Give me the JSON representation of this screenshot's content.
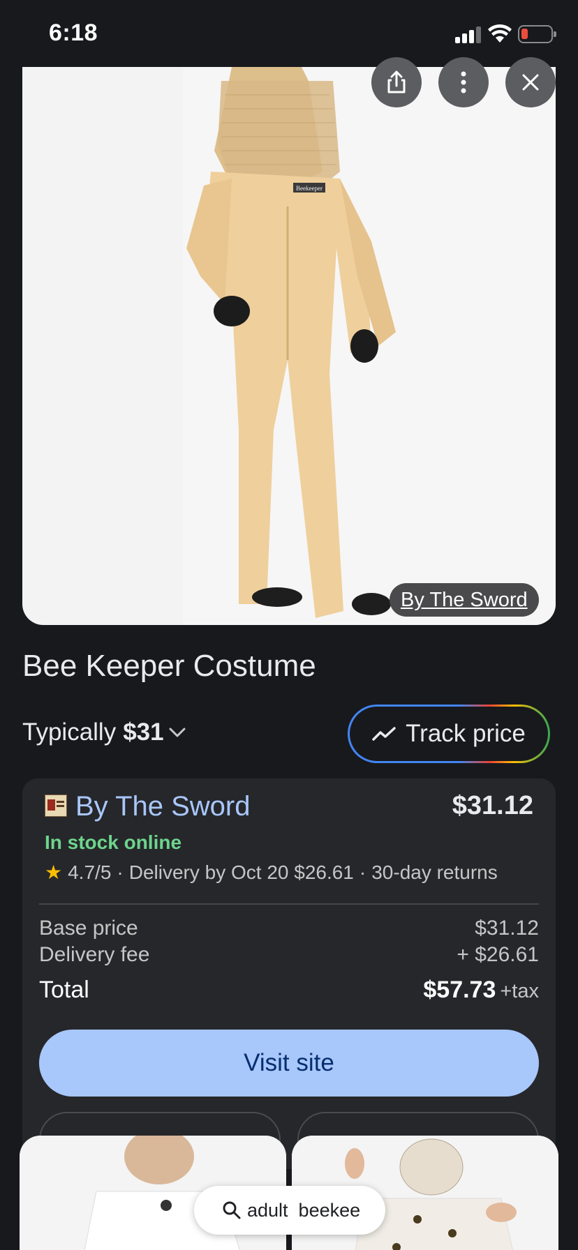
{
  "status_bar": {
    "time": "6:18",
    "icons": [
      "signal-icon",
      "wifi-icon",
      "battery-low-icon"
    ],
    "battery_color": "#eb4d3d"
  },
  "hero": {
    "image_badge": "Beekeeper",
    "source_chip": "By The Sword",
    "buttons": [
      "share-icon",
      "more-vert-icon",
      "close-icon"
    ]
  },
  "product": {
    "title": "Bee Keeper Costume",
    "typical_label": "Typically",
    "typical_price": "$31",
    "track_price_label": "Track price"
  },
  "offer": {
    "merchant": "By The Sword",
    "price": "$31.12",
    "stock": "In stock online",
    "rating": "4.7/5",
    "delivery": "Delivery by Oct 20 $26.61",
    "returns": "30-day returns",
    "separator": "·",
    "base_price_label": "Base price",
    "base_price_value": "$31.12",
    "delivery_fee_label": "Delivery fee",
    "delivery_fee_value": "+ $26.61",
    "total_label": "Total",
    "total_value": "$57.73",
    "tax_label": "+tax",
    "visit_label": "Visit site"
  },
  "search": {
    "query": "adult  beekee"
  },
  "colors": {
    "background": "#18191d",
    "card": "#26272b",
    "link": "#a8c7fa",
    "in_stock": "#6dd58c",
    "visit_button": "#a8c7fa"
  }
}
